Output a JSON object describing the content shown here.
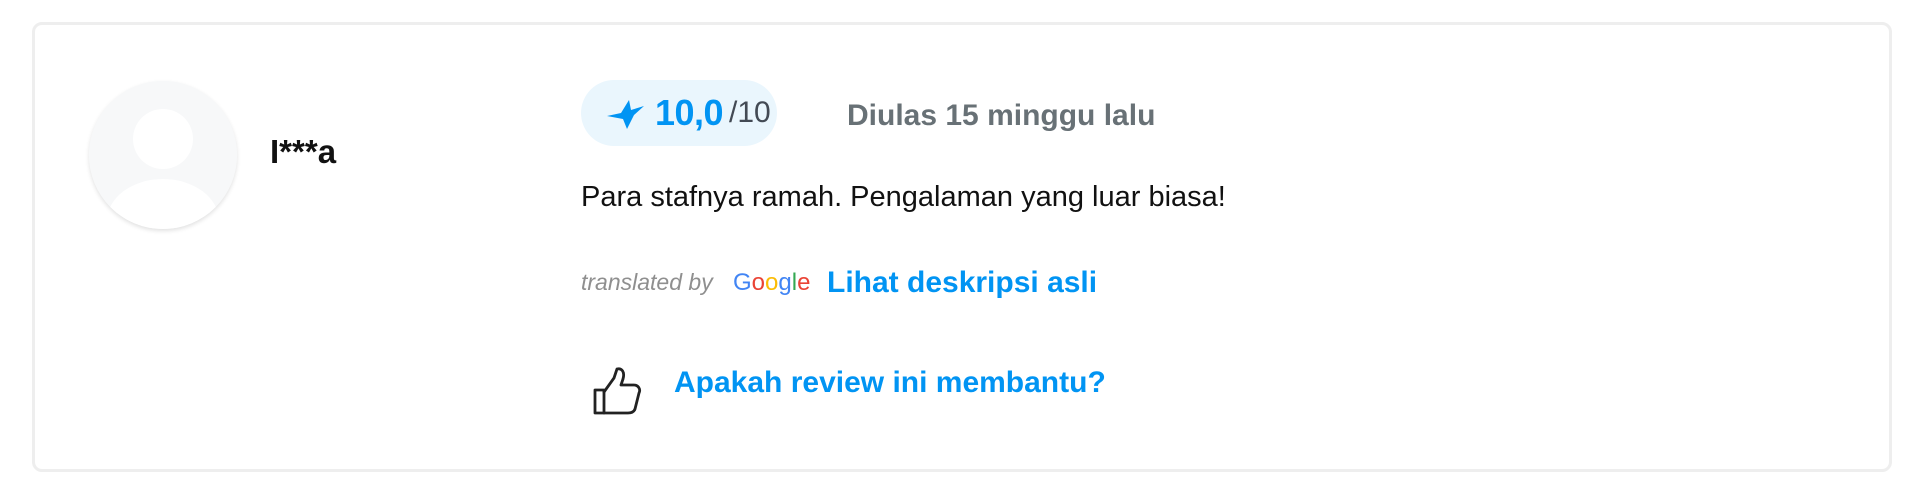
{
  "review": {
    "username": "I***a",
    "score": "10,0",
    "score_max": "/10",
    "reviewed_time": "Diulas 15 minggu lalu",
    "text": "Para stafnya ramah. Pengalaman yang luar biasa!",
    "translated_by": "translated by",
    "google_logo": "Google",
    "original_link": "Lihat deskripsi asli",
    "helpful_prompt": "Apakah review ini membantu?"
  },
  "icons": {
    "avatar": "avatar-placeholder-icon",
    "score": "bird-logo-icon",
    "helpful": "thumbs-up-icon"
  },
  "colors": {
    "accent": "#0194f3",
    "score_bg": "#eaf6fd",
    "muted": "#687176",
    "text": "#111111"
  }
}
